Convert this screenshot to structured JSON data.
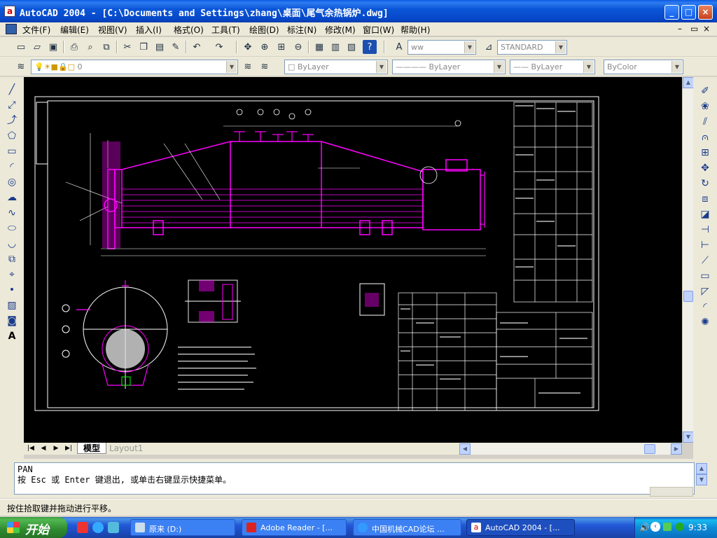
{
  "window": {
    "title": "AutoCAD 2004 - [C:\\Documents and Settings\\zhang\\桌面\\尾气余热锅炉.dwg]",
    "controls": [
      "_",
      "□",
      "×"
    ]
  },
  "menu": {
    "items": [
      "文件(F)",
      "编辑(E)",
      "视图(V)",
      "插入(I)",
      "格式(O)",
      "工具(T)",
      "绘图(D)",
      "标注(N)",
      "修改(M)",
      "窗口(W)",
      "帮助(H)"
    ],
    "mdi_controls": [
      "–",
      "▭",
      "×"
    ]
  },
  "toolbar_standard": {
    "font_combo": "ww",
    "dimstyle_combo": "STANDARD"
  },
  "toolbar_layers": {
    "layer_combo": "0",
    "color_combo": "ByLayer",
    "linetype_combo": "ByLayer",
    "lineweight_combo": "ByLayer",
    "plotstyle_combo": "ByColor"
  },
  "tabs": {
    "model": "模型",
    "layout": "Layout1"
  },
  "command": {
    "line1": "PAN",
    "line2": "按 Esc 或 Enter 键退出, 或单击右键显示快捷菜单。"
  },
  "status": {
    "text": "按住拾取键并拖动进行平移。"
  },
  "taskbar": {
    "start": "开始",
    "items": [
      {
        "label": "原来 (D:)"
      },
      {
        "label": "Adobe Reader - [..."
      },
      {
        "label": "中国机械CAD论坛 ..."
      },
      {
        "label": "AutoCAD 2004 - [..."
      }
    ],
    "clock": "9:33"
  },
  "colors": {
    "drawing_bg": "#000000",
    "magenta": "#ff00ff",
    "white": "#ffffff",
    "cyan": "#00ffff"
  }
}
